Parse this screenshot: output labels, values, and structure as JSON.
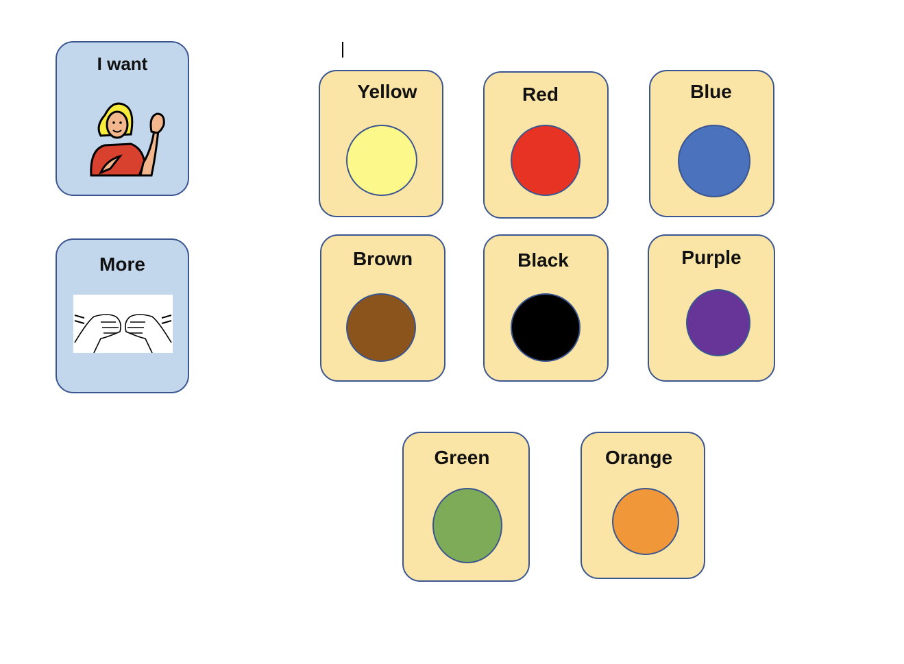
{
  "cards": {
    "i_want": {
      "label": "I want",
      "icon": "person-pointing-self-icon"
    },
    "more": {
      "label": "More",
      "icon": "sign-more-hands-icon"
    }
  },
  "colors": [
    {
      "label": "Yellow",
      "fill": "#fdf88a"
    },
    {
      "label": "Red",
      "fill": "#e63323"
    },
    {
      "label": "Blue",
      "fill": "#4a72bd"
    },
    {
      "label": "Brown",
      "fill": "#8a541c"
    },
    {
      "label": "Black",
      "fill": "#000000"
    },
    {
      "label": "Purple",
      "fill": "#673597"
    },
    {
      "label": "Green",
      "fill": "#7dab57"
    },
    {
      "label": "Orange",
      "fill": "#f09839"
    }
  ],
  "theme": {
    "word_card_bg": "#c3d7ec",
    "color_card_bg": "#fbe5a6",
    "border": "#3a5590"
  }
}
